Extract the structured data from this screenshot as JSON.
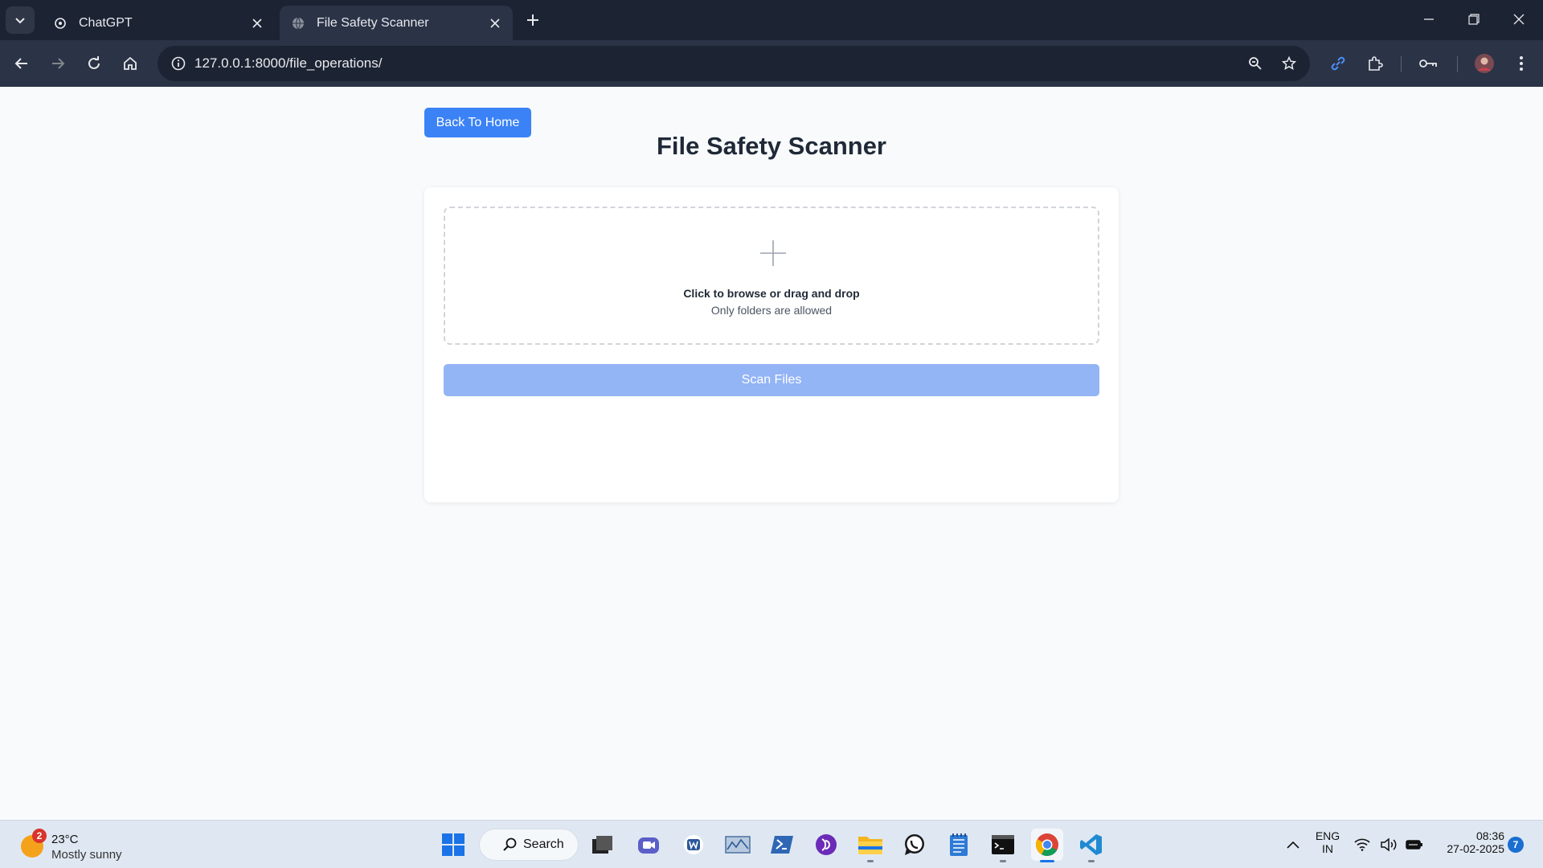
{
  "browser": {
    "tabs": [
      {
        "title": "ChatGPT",
        "active": false
      },
      {
        "title": "File Safety Scanner",
        "active": true
      }
    ],
    "url": "127.0.0.1:8000/file_operations/"
  },
  "page": {
    "back_button": "Back To Home",
    "title": "File Safety Scanner",
    "dropzone": {
      "main_text": "Click to browse or drag and drop",
      "sub_text": "Only folders are allowed"
    },
    "scan_button": "Scan Files",
    "colors": {
      "primary": "#3b82f6",
      "primary_disabled": "#93b4f5",
      "background": "#f8fafc"
    }
  },
  "taskbar": {
    "weather": {
      "badge": "2",
      "temperature": "23°C",
      "condition": "Mostly sunny"
    },
    "search_label": "Search",
    "language": {
      "line1": "ENG",
      "line2": "IN"
    },
    "clock": {
      "time": "08:36",
      "date": "27-02-2025"
    },
    "notification_count": "7"
  }
}
